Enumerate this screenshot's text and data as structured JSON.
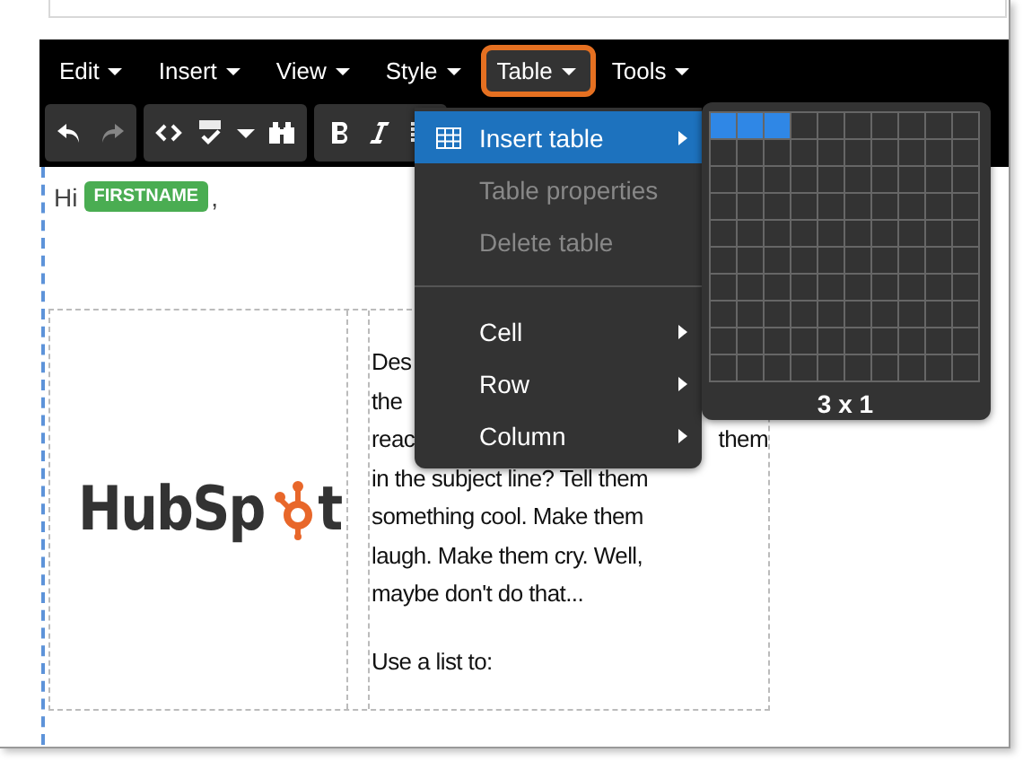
{
  "menubar": [
    {
      "label": "Edit",
      "selected": false
    },
    {
      "label": "Insert",
      "selected": false
    },
    {
      "label": "View",
      "selected": false
    },
    {
      "label": "Style",
      "selected": false
    },
    {
      "label": "Table",
      "selected": true
    },
    {
      "label": "Tools",
      "selected": false
    }
  ],
  "toolbar": [
    {
      "buttons": [
        {
          "kind": "undo",
          "disabled": false
        },
        {
          "kind": "redo",
          "disabled": true
        }
      ]
    },
    {
      "buttons": [
        {
          "kind": "code",
          "disabled": false
        },
        {
          "kind": "spellcheck",
          "disabled": false
        },
        {
          "kind": "caret",
          "disabled": false
        },
        {
          "kind": "find",
          "disabled": false
        }
      ]
    },
    {
      "buttons": [
        {
          "kind": "bold"
        },
        {
          "kind": "italic"
        },
        {
          "kind": "align"
        }
      ]
    }
  ],
  "table_menu": {
    "items": [
      {
        "kind": "grid_item",
        "label": "Insert table",
        "selected": true,
        "disabled": false,
        "submenu": true
      },
      {
        "kind": "item",
        "label": "Table properties",
        "selected": false,
        "disabled": true,
        "submenu": false
      },
      {
        "kind": "item",
        "label": "Delete table",
        "selected": false,
        "disabled": true,
        "submenu": false
      },
      {
        "kind": "separator"
      },
      {
        "kind": "item",
        "label": "Cell",
        "selected": false,
        "disabled": false,
        "submenu": true
      },
      {
        "kind": "item",
        "label": "Row",
        "selected": false,
        "disabled": false,
        "submenu": true
      },
      {
        "kind": "item",
        "label": "Column",
        "selected": false,
        "disabled": false,
        "submenu": true
      }
    ]
  },
  "grid_picker": {
    "rows": [
      {
        "selected": [
          true,
          true,
          true,
          false,
          false,
          false,
          false,
          false,
          false,
          false
        ]
      },
      {
        "selected": [
          false,
          false,
          false,
          false,
          false,
          false,
          false,
          false,
          false,
          false
        ]
      },
      {
        "selected": [
          false,
          false,
          false,
          false,
          false,
          false,
          false,
          false,
          false,
          false
        ]
      },
      {
        "selected": [
          false,
          false,
          false,
          false,
          false,
          false,
          false,
          false,
          false,
          false
        ]
      },
      {
        "selected": [
          false,
          false,
          false,
          false,
          false,
          false,
          false,
          false,
          false,
          false
        ]
      },
      {
        "selected": [
          false,
          false,
          false,
          false,
          false,
          false,
          false,
          false,
          false,
          false
        ]
      },
      {
        "selected": [
          false,
          false,
          false,
          false,
          false,
          false,
          false,
          false,
          false,
          false
        ]
      },
      {
        "selected": [
          false,
          false,
          false,
          false,
          false,
          false,
          false,
          false,
          false,
          false
        ]
      },
      {
        "selected": [
          false,
          false,
          false,
          false,
          false,
          false,
          false,
          false,
          false,
          false
        ]
      },
      {
        "selected": [
          false,
          false,
          false,
          false,
          false,
          false,
          false,
          false,
          false,
          false
        ]
      }
    ],
    "size_label": "3 x 1"
  },
  "content": {
    "greeting": "Hi",
    "merge_tag": "FIRSTNAME",
    "punctuation": ",",
    "logo": {
      "before": "HubSp",
      "after": "t"
    },
    "paragraphs": [
      {
        "lines": [
          [
            "Des"
          ],
          [
            "the"
          ],
          [
            "reac",
            "them"
          ],
          [
            "in the subject line? Tell them"
          ],
          [
            "something cool. Make them"
          ],
          [
            "laugh. Make them cry. Well,"
          ],
          [
            "maybe don't do that..."
          ]
        ]
      },
      {
        "lines": [
          [
            "Use a list to:"
          ]
        ]
      }
    ]
  }
}
